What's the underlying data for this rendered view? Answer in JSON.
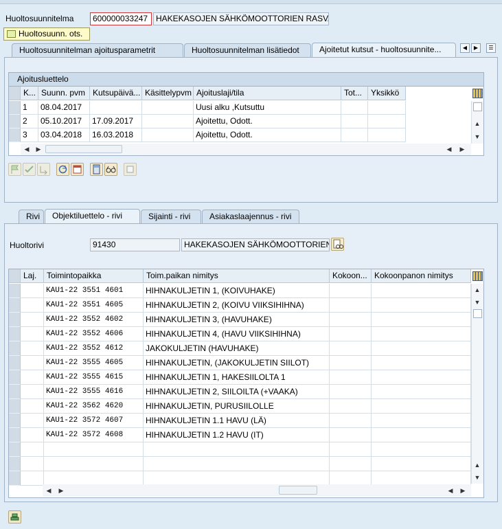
{
  "header": {
    "label": "Huoltosuunnitelma",
    "number": "600000033247",
    "description": "HAKEKASOJEN SÄHKÖMOOTTORIEN RASVA...",
    "tooltip": "Huoltosuunn. ots."
  },
  "top_tabs": [
    {
      "label": "Huoltosuunnitelman ajoitusparametrit"
    },
    {
      "label": "Huoltosuunnitelman lisätiedot"
    },
    {
      "label": "Ajoitetut kutsut - huoltosuunnite..."
    }
  ],
  "schedule": {
    "title": "Ajoitusluettelo",
    "columns": [
      "K...",
      "Suunn. pvm",
      "Kutsupäivä...",
      "Käsittelypvm",
      "Ajoituslaji/tila",
      "Tot...",
      "Yksikkö"
    ],
    "rows": [
      [
        "1",
        "08.04.2017",
        "",
        "",
        "Uusi alku ,Kutsuttu",
        "",
        ""
      ],
      [
        "2",
        "05.10.2017",
        "17.09.2017",
        "",
        "Ajoitettu, Odott.",
        "",
        ""
      ],
      [
        "3",
        "03.04.2018",
        "16.03.2018",
        "",
        "Ajoitettu, Odott.",
        "",
        ""
      ]
    ]
  },
  "bottom_tabs": [
    {
      "label": "Rivi"
    },
    {
      "label": "Objektiluettelo - rivi"
    },
    {
      "label": "Sijainti - rivi"
    },
    {
      "label": "Asiakaslaajennus - rivi"
    }
  ],
  "item": {
    "label": "Huoltorivi",
    "number": "91430",
    "description": "HAKEKASOJEN SÄHKÖMOOTTORIEN..."
  },
  "objects": {
    "columns": [
      "Laj.",
      "Toimintopaikka",
      "Toim.paikan nimitys",
      "Kokoon...",
      "Kokoonpanon nimitys"
    ],
    "rows": [
      [
        "",
        "KAU1-22  3551  4601",
        "HIHNAKULJETIN 1, (KOIVUHAKE)",
        "",
        ""
      ],
      [
        "",
        "KAU1-22  3551  4605",
        "HIHNAKULJETIN 2, (KOIVU VIIKSIHIHNA)",
        "",
        ""
      ],
      [
        "",
        "KAU1-22  3552  4602",
        "HIHNAKULJETIN 3, (HAVUHAKE)",
        "",
        ""
      ],
      [
        "",
        "KAU1-22  3552  4606",
        "HIHNAKULJETIN 4, (HAVU VIIKSIHIHNA)",
        "",
        ""
      ],
      [
        "",
        "KAU1-22  3552  4612",
        "JAKOKULJETIN (HAVUHAKE)",
        "",
        ""
      ],
      [
        "",
        "KAU1-22  3555  4605",
        "HIHNAKULJETIN, (JAKOKULJETIN SIILOT)",
        "",
        ""
      ],
      [
        "",
        "KAU1-22  3555  4615",
        "HIHNAKULJETIN 1, HAKESIILOLTA 1",
        "",
        ""
      ],
      [
        "",
        "KAU1-22  3555  4616",
        "HIHNAKULJETIN 2, SIILOILTA (+VAAKA)",
        "",
        ""
      ],
      [
        "",
        "KAU1-22  3562  4620",
        "HIHNAKULJETIN, PURUSIILOLLE",
        "",
        ""
      ],
      [
        "",
        "KAU1-22  3572  4607",
        "HIHNAKULJETIN 1.1  HAVU (LÄ)",
        "",
        ""
      ],
      [
        "",
        "KAU1-22  3572  4608",
        "HIHNAKULJETIN 1.2  HAVU (IT)",
        "",
        ""
      ],
      [
        "",
        "",
        "",
        "",
        ""
      ],
      [
        "",
        "",
        "",
        "",
        ""
      ],
      [
        "",
        "",
        "",
        "",
        ""
      ]
    ]
  },
  "icons": {
    "toolbar": [
      "flag-icon",
      "confirm-icon",
      "move-icon",
      "refresh-icon",
      "calendar-icon",
      "calculator-icon",
      "glasses-icon",
      "print-preview-icon"
    ],
    "bottom": "stack-icon"
  }
}
